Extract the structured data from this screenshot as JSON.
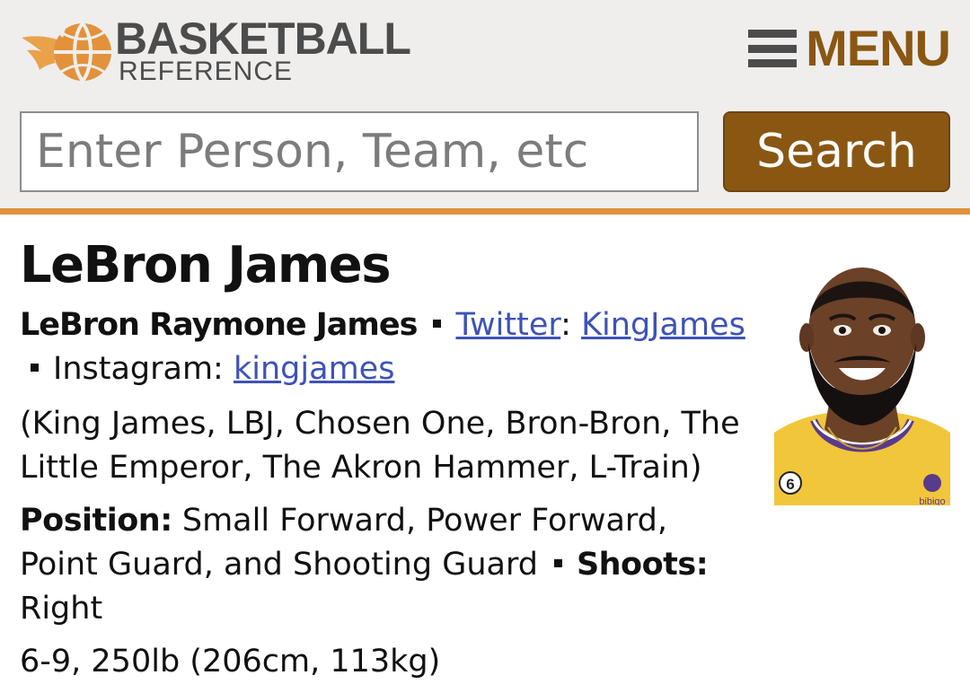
{
  "header": {
    "logo_top": "BASKETBALL",
    "logo_bottom": "REFERENCE",
    "menu_label": "MENU",
    "colors": {
      "background": "#efeeed",
      "accent_orange": "#e0923c",
      "brand_brown": "#8a5713",
      "logo_gray": "#4c4c4d"
    }
  },
  "search": {
    "placeholder": "Enter Person, Team, etc",
    "value": "",
    "button_label": "Search"
  },
  "player": {
    "name": "LeBron James",
    "full_name": "LeBron Raymone James",
    "twitter_label": "Twitter",
    "twitter_handle": "KingJames",
    "instagram_label": "Instagram:",
    "instagram_handle": "kingjames",
    "nicknames": "(King James, LBJ, Chosen One, Bron-Bron, The Little Emperor, The Akron Hammer, L-Train)",
    "position_label": "Position:",
    "position_value": "Small Forward, Power Forward, Point Guard, and Shooting Guard",
    "shoots_label": "Shoots:",
    "shoots_value": "Right",
    "measurements": "6-9, 250lb (206cm, 113kg)",
    "photo_jersey_number": "6",
    "photo_sponsor": "bibigo"
  },
  "icons": {
    "menu": "hamburger-menu-icon",
    "logo": "basketball-logo-icon"
  }
}
